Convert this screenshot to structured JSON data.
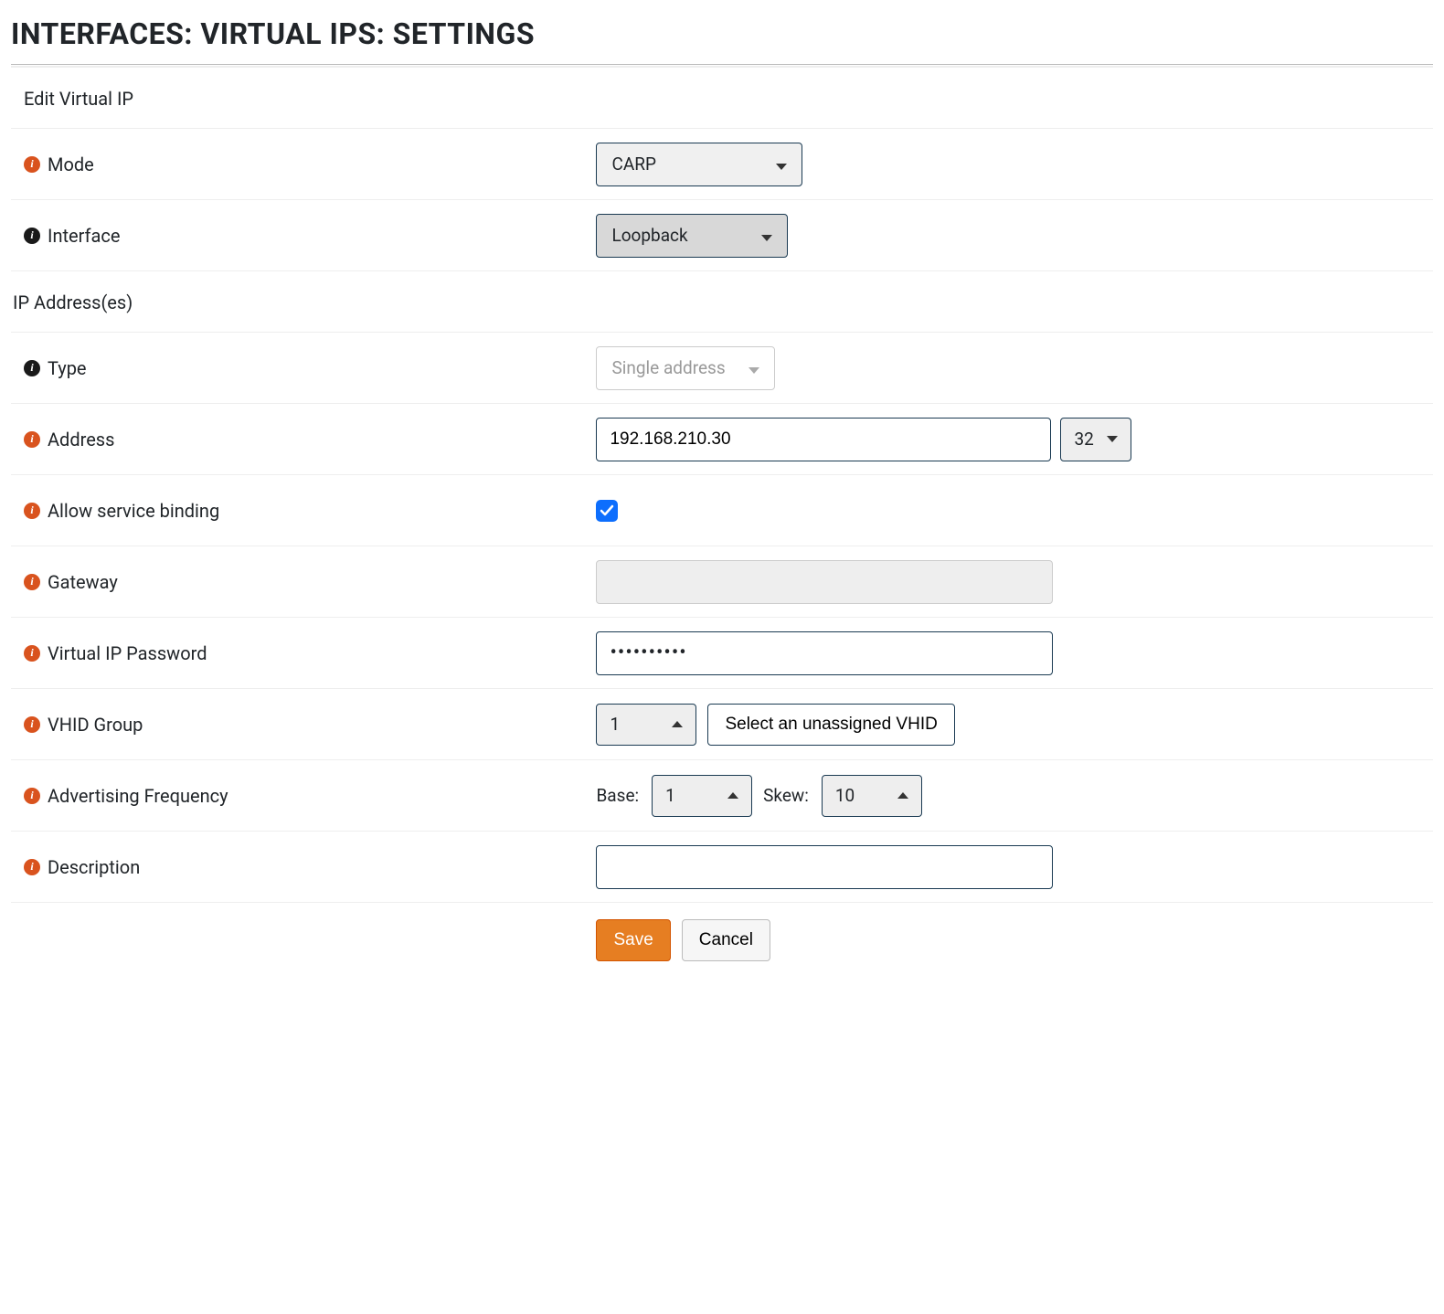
{
  "page": {
    "title": "INTERFACES: VIRTUAL IPS: SETTINGS"
  },
  "sections": {
    "edit_vip": "Edit Virtual IP",
    "ip_addresses": "IP Address(es)"
  },
  "labels": {
    "mode": "Mode",
    "interface": "Interface",
    "type": "Type",
    "address": "Address",
    "allow_binding": "Allow service binding",
    "gateway": "Gateway",
    "vip_password": "Virtual IP Password",
    "vhid_group": "VHID Group",
    "adv_freq": "Advertising Frequency",
    "description": "Description",
    "base": "Base:",
    "skew": "Skew:"
  },
  "values": {
    "mode": "CARP",
    "interface": "Loopback",
    "type": "Single address",
    "address": "192.168.210.30",
    "cidr": "32",
    "allow_binding": true,
    "gateway": "",
    "vip_password_masked": "••••••••••",
    "vhid_group": "1",
    "base": "1",
    "skew": "10",
    "description": ""
  },
  "buttons": {
    "select_vhid": "Select an unassigned VHID",
    "save": "Save",
    "cancel": "Cancel"
  }
}
